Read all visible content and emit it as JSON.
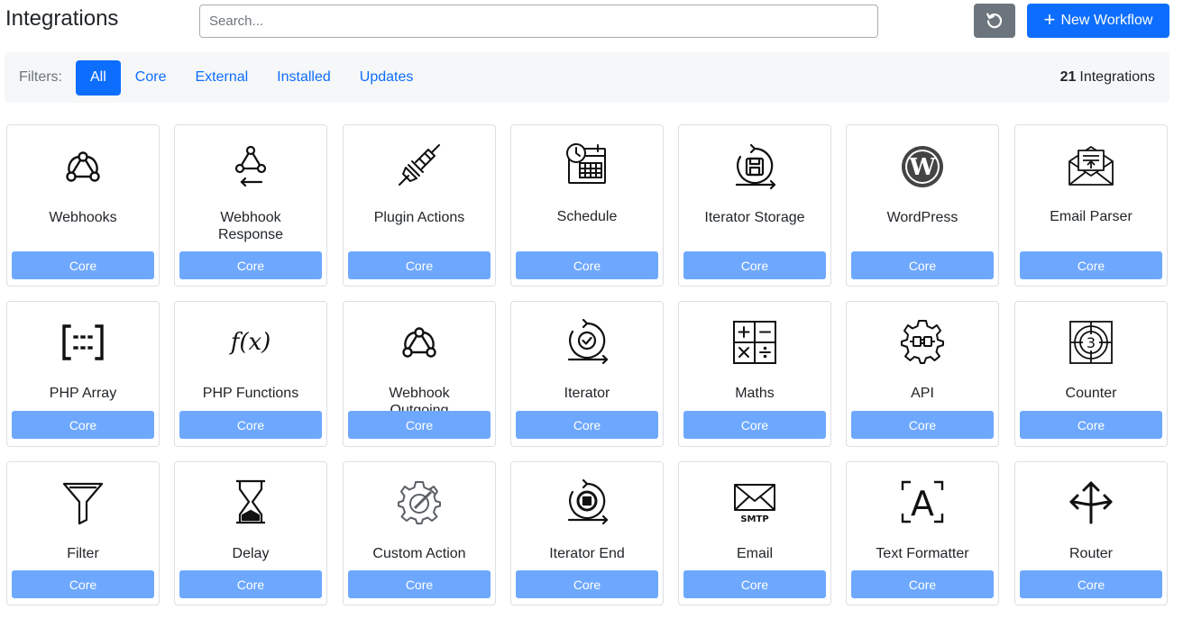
{
  "header": {
    "title": "Integrations",
    "search_placeholder": "Search...",
    "search_value": "",
    "new_workflow_label": "New Workflow"
  },
  "filters": {
    "label": "Filters:",
    "tabs": [
      {
        "label": "All",
        "active": true
      },
      {
        "label": "Core",
        "active": false
      },
      {
        "label": "External",
        "active": false
      },
      {
        "label": "Installed",
        "active": false
      },
      {
        "label": "Updates",
        "active": false
      }
    ],
    "count_number": "21",
    "count_suffix": "Integrations"
  },
  "integrations": [
    {
      "name": "Webhooks",
      "badge": "Core",
      "icon": "webhook-icon"
    },
    {
      "name": "Webhook Response",
      "badge": "Core",
      "icon": "webhook-response-icon"
    },
    {
      "name": "Plugin Actions",
      "badge": "Core",
      "icon": "plug-icon"
    },
    {
      "name": "Schedule",
      "badge": "Core",
      "icon": "calendar-clock-icon"
    },
    {
      "name": "Iterator Storage",
      "badge": "Core",
      "icon": "iterator-storage-icon"
    },
    {
      "name": "WordPress",
      "badge": "Core",
      "icon": "wordpress-icon"
    },
    {
      "name": "Email Parser",
      "badge": "Core",
      "icon": "email-parser-icon"
    },
    {
      "name": "PHP Array",
      "badge": "Core",
      "icon": "php-array-icon"
    },
    {
      "name": "PHP Functions",
      "badge": "Core",
      "icon": "function-icon"
    },
    {
      "name": "Webhook Outgoing",
      "badge": "Core",
      "icon": "webhook-outgoing-icon"
    },
    {
      "name": "Iterator",
      "badge": "Core",
      "icon": "iterator-icon"
    },
    {
      "name": "Maths",
      "badge": "Core",
      "icon": "math-operators-icon"
    },
    {
      "name": "API",
      "badge": "Core",
      "icon": "api-gear-icon"
    },
    {
      "name": "Counter",
      "badge": "Core",
      "icon": "counter-icon"
    },
    {
      "name": "Filter",
      "badge": "Core",
      "icon": "funnel-icon"
    },
    {
      "name": "Delay",
      "badge": "Core",
      "icon": "hourglass-icon"
    },
    {
      "name": "Custom Action",
      "badge": "Core",
      "icon": "custom-action-gear-icon"
    },
    {
      "name": "Iterator End",
      "badge": "Core",
      "icon": "iterator-end-icon"
    },
    {
      "name": "Email",
      "badge": "Core",
      "icon": "smtp-envelope-icon",
      "icon_text": "SMTP"
    },
    {
      "name": "Text Formatter",
      "badge": "Core",
      "icon": "text-formatter-icon",
      "icon_text": "A"
    },
    {
      "name": "Router",
      "badge": "Core",
      "icon": "router-arrows-icon"
    }
  ],
  "colors": {
    "primary": "#0d6efd",
    "badge": "#6ea8fe",
    "secondary": "#6c757d",
    "filter_bar_bg": "#f6f7f8"
  }
}
